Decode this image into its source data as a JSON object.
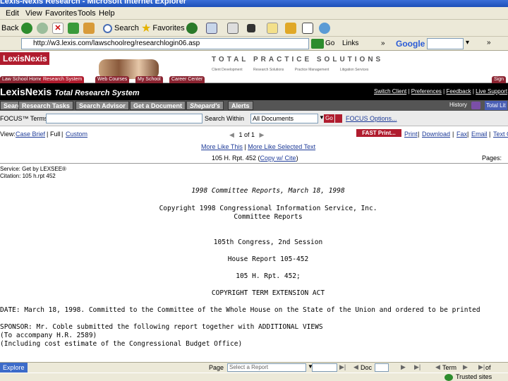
{
  "window": {
    "title": "Lexis-Nexis Research - Microsoft Internet Explorer"
  },
  "menu": [
    "Edit",
    "View",
    "Favorites",
    "Tools",
    "Help"
  ],
  "toolbar": {
    "back": "Back",
    "search": "Search",
    "favorites": "Favorites"
  },
  "address": {
    "url": "http://w3.lexis.com/lawschoolreg/researchlogin06.asp",
    "go": "Go",
    "links": "Links",
    "google": "Google"
  },
  "lexis_header": {
    "logo": "LexisNexis",
    "total_practice": "TOTAL PRACTICE SOLUTIONS",
    "practice_areas": [
      "Client Development",
      "Research Solutions",
      "Practice Management",
      "Litigation Services"
    ],
    "nav_tabs": [
      "Law School Home",
      "Research System",
      "Web Courses",
      "My School",
      "Career Center",
      "Sign"
    ]
  },
  "research_bar": {
    "brand": "LexisNexis",
    "system_name": "Total Research System",
    "links": [
      "Switch Client",
      "Preferences",
      "Feedback",
      "Live Support"
    ],
    "history": "History",
    "total_btn": "Total Lit"
  },
  "tabs": [
    "Search",
    "Research Tasks",
    "Search Advisor",
    "Get a Document",
    "Shepard's",
    "Alerts"
  ],
  "focus": {
    "label": "FOCUS™ Terms",
    "terms_value": "",
    "search_within_label": "Search Within",
    "search_within_value": "All Documents",
    "go": "Go",
    "options": "FOCUS Options..."
  },
  "view": {
    "label": "View:",
    "case_brief": "Case Brief",
    "full": "Full",
    "custom": "Custom",
    "fast_print": "FAST Print...",
    "print": "Print",
    "download": "Download",
    "fax": "Fax",
    "email": "Email",
    "text_only": "Text Only"
  },
  "doc_nav": {
    "position": "1 of 1"
  },
  "more_like": {
    "this": "More Like This",
    "selected": "More Like Selected Text"
  },
  "citation": {
    "cite": "105 H. Rpt. 452",
    "copy": "Copy w/ Cite",
    "pages": "Pages:"
  },
  "service": {
    "line1": "Service: Get by LEXSEE®",
    "line2": "Citation: 105 h.rpt 452"
  },
  "document": {
    "l1": "1998 Committee Reports, March 18, 1998",
    "l2": "Copyright 1998 Congressional Information Service, Inc.",
    "l3": "Committee Reports",
    "l4": "105th Congress, 2nd Session",
    "l5": "House Report 105-452",
    "l6": "105 H. Rpt. 452;",
    "l7": "COPYRIGHT TERM EXTENSION ACT",
    "date_line": "DATE: March 18, 1998. Committed to the Committee of the Whole House on the State of the Union and ordered to be printed",
    "sponsor_line": "SPONSOR: Mr. Coble submitted the following report together with ADDITIONAL VIEWS",
    "accompany": "(To accompany H.R. 2589)",
    "including": "(Including cost estimate of the Congressional Budget Office)"
  },
  "bottom": {
    "explore": "Explore",
    "page": "Page",
    "select_report": "Select a Report",
    "doc": "Doc",
    "term": "Term",
    "of": "of"
  },
  "status": {
    "trusted": "Trusted sites"
  }
}
